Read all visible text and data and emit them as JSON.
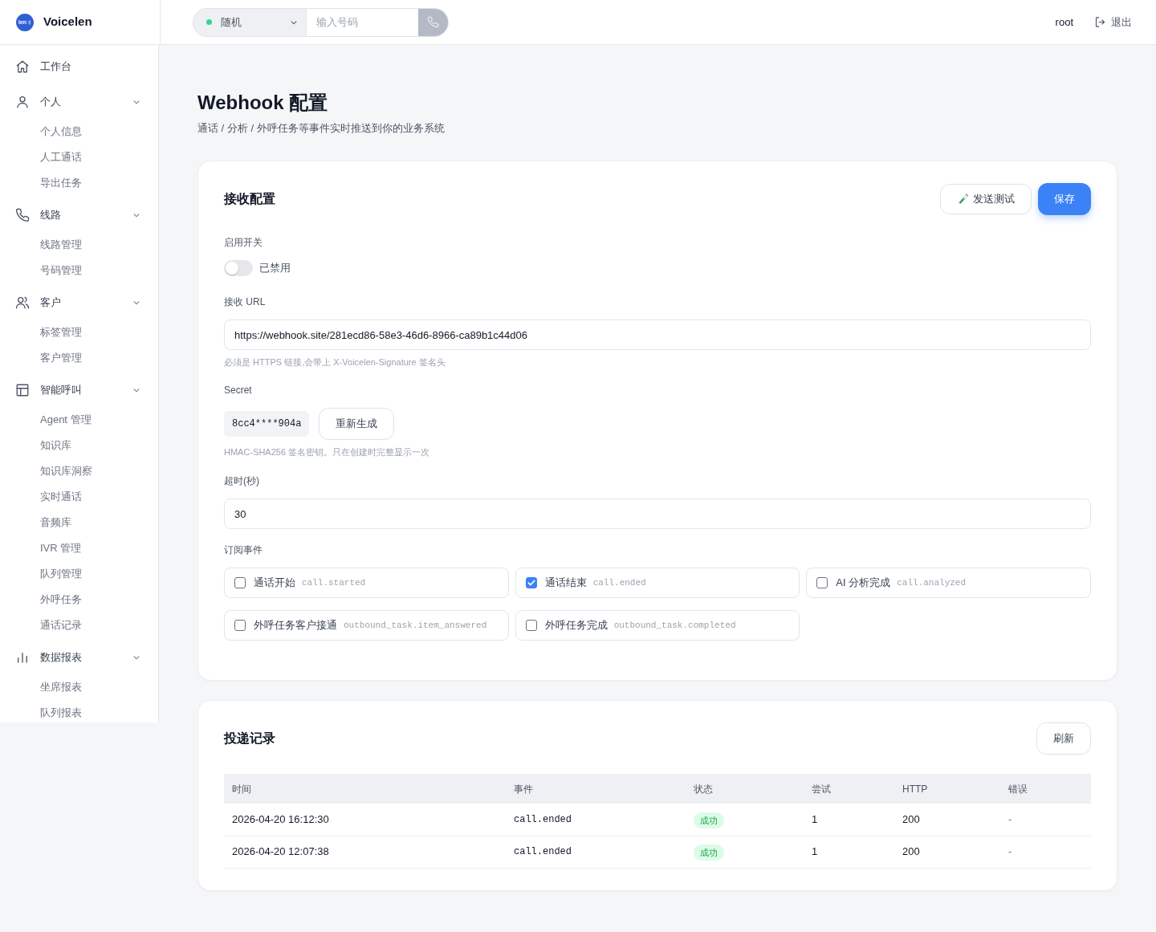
{
  "header": {
    "brand": {
      "mark_text": "len",
      "name": "Voicelen"
    },
    "dialer": {
      "line": "随机",
      "line_online": true,
      "placeholder": "输入号码"
    },
    "user": "root",
    "logout": "退出"
  },
  "sidebar": {
    "items": [
      {
        "label": "工作台",
        "kind": "link",
        "selected": false
      },
      {
        "label": "个人",
        "kind": "group",
        "expanded": true,
        "children": [
          {
            "label": "个人信息",
            "selected": false
          },
          {
            "label": "人工通话",
            "selected": false
          },
          {
            "label": "导出任务",
            "selected": false
          }
        ]
      },
      {
        "label": "线路",
        "kind": "group",
        "expanded": true,
        "children": [
          {
            "label": "线路管理",
            "selected": false
          },
          {
            "label": "号码管理",
            "selected": false
          }
        ]
      },
      {
        "label": "客户",
        "kind": "group",
        "expanded": true,
        "children": [
          {
            "label": "标签管理",
            "selected": false
          },
          {
            "label": "客户管理",
            "selected": false
          }
        ]
      },
      {
        "label": "智能呼叫",
        "kind": "group",
        "expanded": true,
        "children": [
          {
            "label": "Agent 管理",
            "selected": false
          },
          {
            "label": "知识库",
            "selected": false
          },
          {
            "label": "知识库洞察",
            "selected": false
          },
          {
            "label": "实时通话",
            "selected": false
          },
          {
            "label": "音频库",
            "selected": false
          },
          {
            "label": "IVR 管理",
            "selected": false
          },
          {
            "label": "队列管理",
            "selected": false
          },
          {
            "label": "外呼任务",
            "selected": false
          },
          {
            "label": "通话记录",
            "selected": false
          }
        ]
      },
      {
        "label": "数据报表",
        "kind": "group",
        "expanded": true,
        "children": [
          {
            "label": "坐席报表",
            "selected": false
          },
          {
            "label": "队列报表",
            "selected": false
          }
        ]
      }
    ]
  },
  "page": {
    "title": "Webhook 配置",
    "subtitle": "通话 / 分析 / 外呼任务等事件实时推送到你的业务系统"
  },
  "config": {
    "title": "接收配置",
    "buttons": [
      {
        "label": "发送测试",
        "kind": "secondary"
      },
      {
        "label": "保存",
        "kind": "primary"
      }
    ],
    "enable": {
      "label": "启用开关",
      "on": false,
      "state_text": "已禁用"
    },
    "url": {
      "label": "接收 URL",
      "value": "https://webhook.site/281ecd86-58e3-46d6-8966-ca89b1c44d06",
      "hint": "必须是 HTTPS 链接,会带上 X-Voicelen-Signature 签名头"
    },
    "secret": {
      "label": "Secret",
      "value": "8cc4****904a",
      "button": "重新生成",
      "hint": "HMAC-SHA256 签名密钥。只在创建时完整显示一次"
    },
    "timeout": {
      "label": "超时(秒)",
      "value": "30"
    },
    "events": {
      "label": "订阅事件",
      "items": [
        {
          "name": "通话开始",
          "code": "call.started",
          "checked": false
        },
        {
          "name": "通话结束",
          "code": "call.ended",
          "checked": true
        },
        {
          "name": "AI 分析完成",
          "code": "call.analyzed",
          "checked": false
        },
        {
          "name": "外呼任务客户接通",
          "code": "outbound_task.item_answered",
          "checked": false
        },
        {
          "name": "外呼任务完成",
          "code": "outbound_task.completed",
          "checked": false
        }
      ]
    }
  },
  "deliveries": {
    "title": "投递记录",
    "refresh": "刷新",
    "table": {
      "columns": [
        "时间",
        "事件",
        "状态",
        "尝试",
        "HTTP",
        "错误"
      ],
      "rows": [
        {
          "time": "2026-04-20 16:12:30",
          "event": "call.ended",
          "status": "成功",
          "attempts": "1",
          "http": "200",
          "error": "-"
        },
        {
          "time": "2026-04-20 12:07:38",
          "event": "call.ended",
          "status": "成功",
          "attempts": "1",
          "http": "200",
          "error": "-"
        }
      ]
    }
  }
}
